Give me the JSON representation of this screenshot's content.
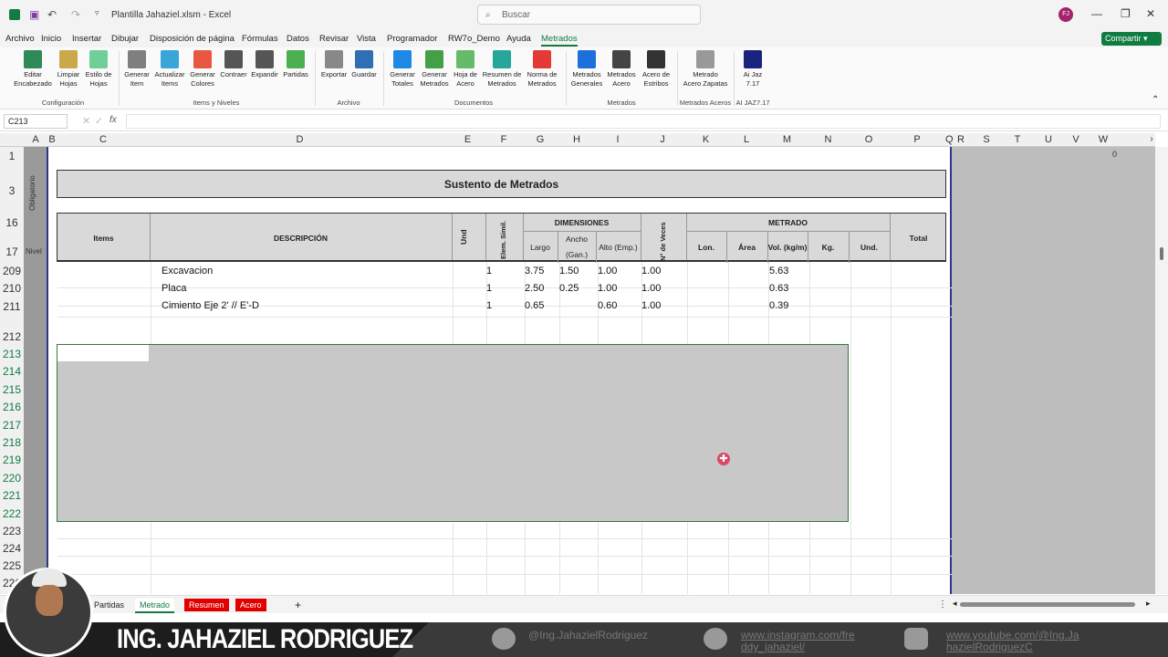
{
  "titlebar": {
    "quick_access": [
      "save-icon",
      "undo-icon",
      "redo-icon"
    ],
    "doc_title": "Plantilla Jahaziel.xlsm - Excel",
    "search_placeholder": "Buscar",
    "avatar": "FJ"
  },
  "menu": {
    "items": [
      "Archivo",
      "Inicio",
      "Insertar",
      "Dibujar",
      "Disposición de página",
      "Fórmulas",
      "Datos",
      "Revisar",
      "Vista",
      "Programador",
      "RW7o_Demo",
      "Ayuda",
      "Metrados"
    ],
    "share": "Compartir"
  },
  "ribbon": {
    "buttons": [
      {
        "l1": "Editar",
        "l2": "Encabezado"
      },
      {
        "l1": "Limpiar",
        "l2": "Hojas"
      },
      {
        "l1": "Estilo de",
        "l2": "Hojas"
      },
      {
        "l1": "Generar",
        "l2": "Item"
      },
      {
        "l1": "Actualizar",
        "l2": "Items"
      },
      {
        "l1": "Generar",
        "l2": "Colores"
      },
      {
        "l1": "Contraer",
        "l2": ""
      },
      {
        "l1": "Expandir",
        "l2": ""
      },
      {
        "l1": "Partidas",
        "l2": ""
      },
      {
        "l1": "Exportar",
        "l2": ""
      },
      {
        "l1": "Guardar",
        "l2": ""
      },
      {
        "l1": "Generar",
        "l2": "Totales"
      },
      {
        "l1": "Generar",
        "l2": "Metrados"
      },
      {
        "l1": "Hoja de",
        "l2": "Acero"
      },
      {
        "l1": "Resumen de",
        "l2": "Metrados"
      },
      {
        "l1": "Norma de",
        "l2": "Metrados"
      },
      {
        "l1": "Metrados",
        "l2": "Generales"
      },
      {
        "l1": "Metrados",
        "l2": "Acero"
      },
      {
        "l1": "Acero de",
        "l2": "Estribos"
      },
      {
        "l1": "Metrado",
        "l2": "Acero Zapatas"
      },
      {
        "l1": "Ai Jaz",
        "l2": "7.17"
      }
    ],
    "groups": [
      "Configuración",
      "Items y Niveles",
      "Archivo",
      "Documentos",
      "Metrados",
      "Metrados Aceros",
      "AI JAZ7.17"
    ]
  },
  "formula": {
    "namebox": "C213",
    "fx": "fx",
    "value": ""
  },
  "columns": [
    "A",
    "B",
    "C",
    "D",
    "E",
    "F",
    "G",
    "H",
    "I",
    "J",
    "K",
    "L",
    "M",
    "N",
    "O",
    "P",
    "Q",
    "R",
    "S",
    "T",
    "U",
    "V",
    "W"
  ],
  "rows": [
    "1",
    "3",
    "16",
    "17",
    "209",
    "210",
    "211",
    "212",
    "213",
    "214",
    "215",
    "216",
    "217",
    "218",
    "219",
    "220",
    "221",
    "222",
    "223",
    "224",
    "225",
    "226"
  ],
  "gutter": {
    "label1": "Obligatorio",
    "label2": "Nivel"
  },
  "w_value": "0",
  "sheet": {
    "title": "Sustento de Metrados",
    "headers": {
      "items": "Items",
      "desc": "DESCRIPCIÓN",
      "und": "Und",
      "elem": "Elem. Simil.",
      "dimensiones": "DIMENSIONES",
      "largo": "Largo",
      "ancho": "Ancho",
      "gan": "(Gan.)",
      "alto": "Alto (Emp.)",
      "veces": "N° de Veces",
      "metrado": "METRADO",
      "lon": "Lon.",
      "area": "Área",
      "vol": "Vol. (kg/m)",
      "kg": "Kg.",
      "und2": "Und.",
      "total": "Total"
    },
    "data": [
      {
        "desc": "Excavacion",
        "elem": "1",
        "largo": "3.75",
        "ancho": "1.50",
        "alto": "1.00",
        "veces": "1.00",
        "vol": "5.63"
      },
      {
        "desc": "Placa",
        "elem": "1",
        "largo": "2.50",
        "ancho": "0.25",
        "alto": "1.00",
        "veces": "1.00",
        "vol": "0.63"
      },
      {
        "desc": "Cimiento Eje 2' // E'-D",
        "elem": "1",
        "largo": "0.65",
        "ancho": "",
        "alto": "0.60",
        "veces": "1.00",
        "vol": "0.39"
      }
    ]
  },
  "tabs": {
    "first": "Partidas",
    "active": "Metrado",
    "red1": "Resumen",
    "red2": "Acero",
    "add": "+"
  },
  "banner": {
    "name": "ING. JAHAZIEL RODRIGUEZ",
    "twitter": "@Ing.JahazielRodriguez",
    "insta1": "www.instagram.com/fre",
    "insta2": "ddy_jahaziel/",
    "yt1": "www.youtube.com/@Ing.Ja",
    "yt2": "hazielRodriguezC"
  },
  "colors": {
    "excel_green": "#107c41",
    "tab_red": "#e00000",
    "sheet_border": "#263a8a"
  }
}
